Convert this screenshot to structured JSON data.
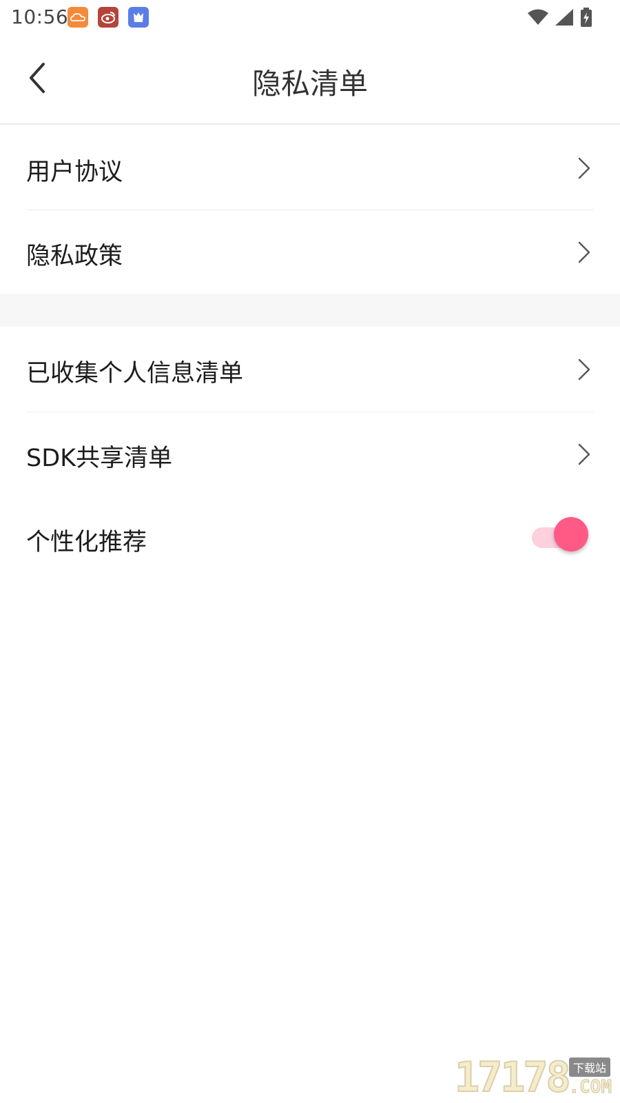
{
  "status_bar": {
    "time": "10:56",
    "notification_icons": [
      "cloud-notification-icon",
      "weibo-notification-icon",
      "app-notification-icon"
    ],
    "system_icons": [
      "wifi-icon",
      "cellular-signal-icon",
      "battery-charging-icon"
    ]
  },
  "header": {
    "title": "隐私清单",
    "back_icon": "chevron-left-icon"
  },
  "sections": [
    {
      "items": [
        {
          "label": "用户协议",
          "icon": "chevron-right-icon"
        },
        {
          "label": "隐私政策",
          "icon": "chevron-right-icon"
        }
      ]
    },
    {
      "items": [
        {
          "label": "已收集个人信息清单",
          "icon": "chevron-right-icon"
        },
        {
          "label": "SDK共享清单",
          "icon": "chevron-right-icon"
        },
        {
          "label": "个性化推荐",
          "toggle": true
        }
      ]
    }
  ],
  "watermark": {
    "number": "17178",
    "badge": "下载站",
    "domain": ".COM"
  },
  "colors": {
    "accent": "#ff5a85",
    "accent_track": "#fcd0dc",
    "divider": "#ececec",
    "section_gap": "#f7f7f7"
  }
}
